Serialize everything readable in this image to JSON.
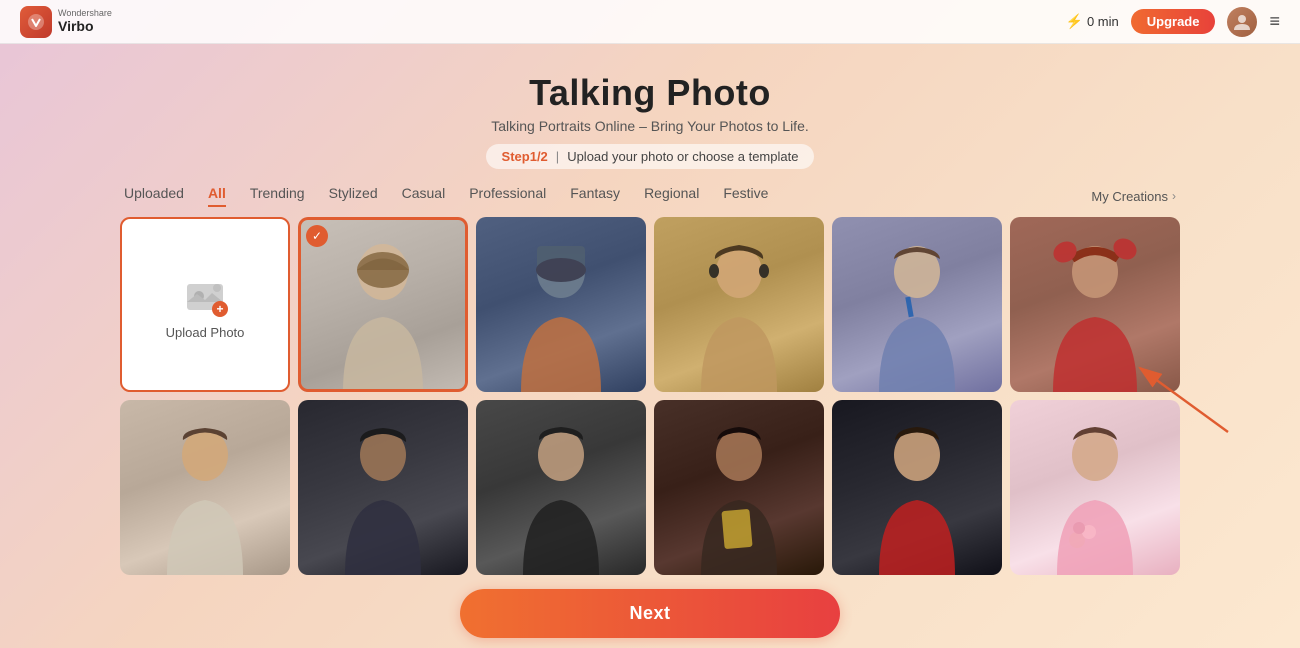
{
  "app": {
    "name": "Virbo",
    "brand": "Wondershare",
    "logo_letter": "V"
  },
  "header": {
    "coins": "0 min",
    "upgrade_label": "Upgrade",
    "menu_icon": "≡"
  },
  "page": {
    "title": "Talking Photo",
    "subtitle": "Talking Portraits Online – Bring Your Photos to Life.",
    "step_label": "Step1/2",
    "step_divider": "|",
    "step_desc": "Upload your photo or choose a template"
  },
  "tabs": {
    "items": [
      {
        "label": "Uploaded",
        "active": false
      },
      {
        "label": "All",
        "active": true
      },
      {
        "label": "Trending",
        "active": false
      },
      {
        "label": "Stylized",
        "active": false
      },
      {
        "label": "Casual",
        "active": false
      },
      {
        "label": "Professional",
        "active": false
      },
      {
        "label": "Fantasy",
        "active": false
      },
      {
        "label": "Regional",
        "active": false
      },
      {
        "label": "Festive",
        "active": false
      }
    ],
    "my_creations": "My Creations"
  },
  "grid": {
    "upload_label": "Upload Photo",
    "photos": [
      {
        "id": 1,
        "selected": true,
        "color_class": "photo-1",
        "desc": "Woman in silver corridor"
      },
      {
        "id": 2,
        "selected": false,
        "color_class": "photo-2",
        "desc": "Cyborg warrior"
      },
      {
        "id": 3,
        "selected": false,
        "color_class": "photo-3",
        "desc": "Young man with headphones"
      },
      {
        "id": 4,
        "selected": false,
        "color_class": "photo-4",
        "desc": "Woman in plaid blazer"
      },
      {
        "id": 5,
        "selected": false,
        "color_class": "photo-5",
        "desc": "Woman in red ruffle"
      },
      {
        "id": 6,
        "selected": false,
        "color_class": "photo-6",
        "desc": "Young man casual"
      },
      {
        "id": 7,
        "selected": false,
        "color_class": "photo-7",
        "desc": "Dark female warrior"
      },
      {
        "id": 8,
        "selected": false,
        "color_class": "photo-8",
        "desc": "Man in dark jacket"
      },
      {
        "id": 9,
        "selected": false,
        "color_class": "photo-9",
        "desc": "Woman with gold card"
      },
      {
        "id": 10,
        "selected": false,
        "color_class": "photo-11",
        "desc": "Young man in red"
      },
      {
        "id": 11,
        "selected": false,
        "color_class": "photo-12",
        "desc": "Woman with pink flowers"
      }
    ]
  },
  "next_button": {
    "label": "Next"
  }
}
